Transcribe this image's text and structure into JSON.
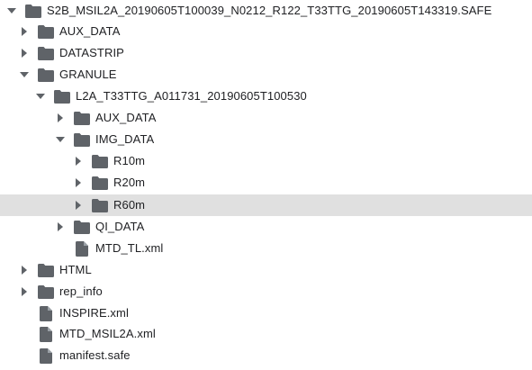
{
  "colors": {
    "icon": "#5f6368",
    "text": "#202124",
    "selected_row": "#e0e0e0",
    "background": "#ffffff"
  },
  "tree": {
    "root": {
      "label": "S2B_MSIL2A_20190605T100039_N0212_R122_T33TTG_20190605T143319.SAFE",
      "icon": "folder-icon",
      "state": "expanded"
    },
    "aux_data": {
      "label": "AUX_DATA",
      "icon": "folder-icon",
      "state": "collapsed"
    },
    "datastrip": {
      "label": "DATASTRIP",
      "icon": "folder-icon",
      "state": "collapsed"
    },
    "granule": {
      "label": "GRANULE",
      "icon": "folder-icon",
      "state": "expanded"
    },
    "l2a": {
      "label": "L2A_T33TTG_A011731_20190605T100530",
      "icon": "folder-icon",
      "state": "expanded"
    },
    "l2a_aux_data": {
      "label": "AUX_DATA",
      "icon": "folder-icon",
      "state": "collapsed"
    },
    "img_data": {
      "label": "IMG_DATA",
      "icon": "folder-icon",
      "state": "expanded"
    },
    "r10m": {
      "label": "R10m",
      "icon": "folder-icon",
      "state": "collapsed"
    },
    "r20m": {
      "label": "R20m",
      "icon": "folder-icon",
      "state": "collapsed"
    },
    "r60m": {
      "label": "R60m",
      "icon": "folder-icon",
      "state": "collapsed",
      "selected": true
    },
    "qi_data": {
      "label": "QI_DATA",
      "icon": "folder-icon",
      "state": "collapsed"
    },
    "mtd_tl": {
      "label": "MTD_TL.xml",
      "icon": "file-icon"
    },
    "html": {
      "label": "HTML",
      "icon": "folder-icon",
      "state": "collapsed"
    },
    "rep_info": {
      "label": "rep_info",
      "icon": "folder-icon",
      "state": "collapsed"
    },
    "inspire": {
      "label": "INSPIRE.xml",
      "icon": "file-icon"
    },
    "mtd_msil2a": {
      "label": "MTD_MSIL2A.xml",
      "icon": "file-icon"
    },
    "manifest": {
      "label": "manifest.safe",
      "icon": "file-icon"
    }
  }
}
